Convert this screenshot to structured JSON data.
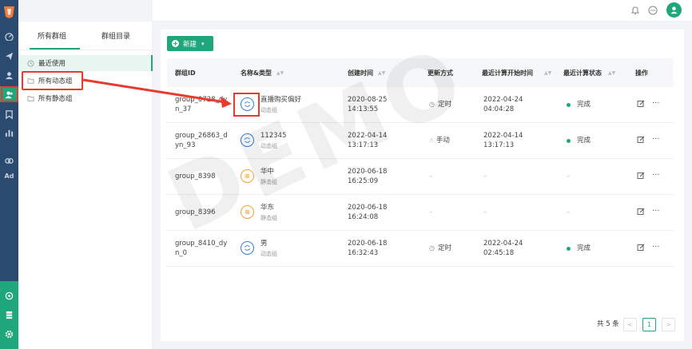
{
  "nav": {
    "ad_label": "Ad"
  },
  "group_panel": {
    "tabs": [
      {
        "label": "所有群组"
      },
      {
        "label": "群组目录"
      }
    ],
    "items": [
      {
        "label": "最近使用"
      },
      {
        "label": "所有动态组"
      },
      {
        "label": "所有静态组"
      }
    ]
  },
  "toolbar": {
    "new_label": "新建"
  },
  "table": {
    "headers": {
      "id": "群组ID",
      "name": "名称&类型",
      "created": "创建时间",
      "update": "更新方式",
      "last_start": "最近计算开始时间",
      "last_status": "最近计算状态",
      "ops": "操作"
    },
    "rows": [
      {
        "id": "group_0728_dyn_37",
        "name": "直播购买偏好",
        "type": "动态组",
        "created": "2020-08-25 14:13:55",
        "update": "定时",
        "last_start": "2022-04-24 04:04:28",
        "status": "完成"
      },
      {
        "id": "group_26863_dyn_93",
        "name": "112345",
        "type": "动态组",
        "created": "2022-04-14 13:17:13",
        "update": "手动",
        "last_start": "2022-04-14 13:17:13",
        "status": "完成"
      },
      {
        "id": "group_8398",
        "name": "华中",
        "type": "静态组",
        "created": "2020-06-18 16:25:09",
        "update": "–",
        "last_start": "–",
        "status": "–"
      },
      {
        "id": "group_8396",
        "name": "华东",
        "type": "静态组",
        "created": "2020-06-18 16:24:08",
        "update": "–",
        "last_start": "–",
        "status": "–"
      },
      {
        "id": "group_8410_dyn_0",
        "name": "男",
        "type": "动态组",
        "created": "2020-06-18 16:32:43",
        "update": "定时",
        "last_start": "2022-04-24 02:45:18",
        "status": "完成"
      }
    ]
  },
  "pagination": {
    "total_label": "共 5 条",
    "current_page": "1",
    "prev": "<",
    "next": ">"
  },
  "watermark": "DEMO",
  "colors": {
    "accent": "#1fa67a",
    "nav_bg": "#2b4a6f",
    "highlight": "#e83a2f",
    "dynamic_icon": "#2f7fe0",
    "static_icon": "#f0a030"
  }
}
